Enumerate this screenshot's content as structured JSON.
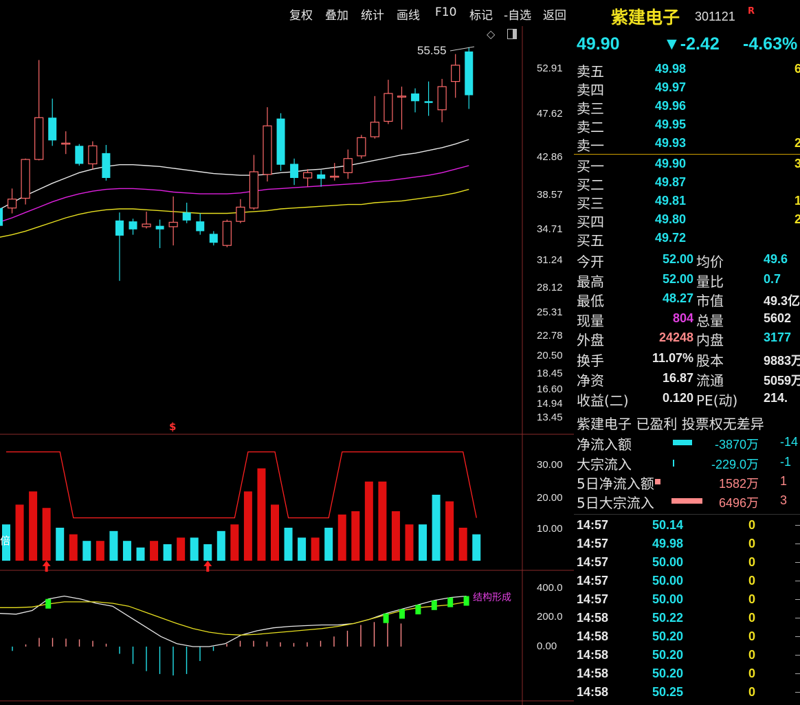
{
  "toolbar": [
    "复权",
    "叠加",
    "统计",
    "画线",
    "F10",
    "标记",
    "-自选",
    "返回"
  ],
  "stock": {
    "name": "紫建电子",
    "code": "301121",
    "flag": "R",
    "price": "49.90",
    "change": "▼-2.42",
    "pct": "-4.63%"
  },
  "main_axis": [
    "52.91",
    "47.62",
    "42.86",
    "38.57",
    "34.71",
    "31.24",
    "28.12",
    "25.31",
    "22.78",
    "20.50",
    "18.45",
    "16.60",
    "14.94",
    "13.45"
  ],
  "high_label": "55.55",
  "vol_axis": [
    "30.00",
    "20.00",
    "10.00"
  ],
  "vol_label": "倍",
  "macd_axis": [
    "400.0",
    "200.0",
    "0.00"
  ],
  "macd_text": "结构形成",
  "signal_char": "$",
  "order_book": {
    "asks": [
      {
        "label": "卖五",
        "price": "49.98",
        "vol": "6"
      },
      {
        "label": "卖四",
        "price": "49.97",
        "vol": ""
      },
      {
        "label": "卖三",
        "price": "49.96",
        "vol": ""
      },
      {
        "label": "卖二",
        "price": "49.95",
        "vol": ""
      },
      {
        "label": "卖一",
        "price": "49.93",
        "vol": "2"
      }
    ],
    "bids": [
      {
        "label": "买一",
        "price": "49.90",
        "vol": "3"
      },
      {
        "label": "买二",
        "price": "49.87",
        "vol": ""
      },
      {
        "label": "买三",
        "price": "49.81",
        "vol": "1"
      },
      {
        "label": "买四",
        "price": "49.80",
        "vol": "2"
      },
      {
        "label": "买五",
        "price": "49.72",
        "vol": ""
      }
    ]
  },
  "stats": [
    {
      "l1": "今开",
      "v1": "52.00",
      "c1": "cyan",
      "l2": "均价",
      "v2": "49.6",
      "c2": "cyan"
    },
    {
      "l1": "最高",
      "v1": "52.00",
      "c1": "cyan",
      "l2": "量比",
      "v2": "0.7",
      "c2": "cyan"
    },
    {
      "l1": "最低",
      "v1": "48.27",
      "c1": "cyan",
      "l2": "市值",
      "v2": "49.3亿",
      "c2": "white"
    },
    {
      "l1": "现量",
      "v1": "804",
      "c1": "magenta",
      "l2": "总量",
      "v2": "5602",
      "c2": "white"
    },
    {
      "l1": "外盘",
      "v1": "24248",
      "c1": "pink",
      "l2": "内盘",
      "v2": "3177",
      "c2": "cyan"
    },
    {
      "l1": "换手",
      "v1": "11.07%",
      "c1": "white",
      "l2": "股本",
      "v2": "9883万",
      "c2": "white"
    },
    {
      "l1": "净资",
      "v1": "16.87",
      "c1": "white",
      "l2": "流通",
      "v2": "5059万",
      "c2": "white"
    },
    {
      "l1": "收益(二)",
      "v1": "0.120",
      "c1": "white",
      "l2": "PE(动)",
      "v2": "214.",
      "c2": "white"
    }
  ],
  "notice": "紫建电子 已盈利 投票权无差异",
  "flows": [
    {
      "label": "净流入额",
      "value": "-3870万",
      "extra": "-14",
      "color": "cyan",
      "bar": "#23e1ea",
      "w": 28,
      "h": 8
    },
    {
      "label": "大宗流入",
      "value": "-229.0万",
      "extra": "-1",
      "color": "cyan",
      "bar": "#23e1ea",
      "w": 2,
      "h": 10
    },
    {
      "label": "5日净流入额",
      "value": "1582万",
      "extra": "1",
      "color": "pink",
      "bar": "#ff8a8a",
      "w": 8,
      "h": 8
    },
    {
      "label": "5日大宗流入",
      "value": "6496万",
      "extra": "3",
      "color": "pink",
      "bar": "#ff8a8a",
      "w": 45,
      "h": 8
    }
  ],
  "ticks": [
    {
      "time": "14:57",
      "price": "50.14",
      "vol": "0"
    },
    {
      "time": "14:57",
      "price": "49.98",
      "vol": "0"
    },
    {
      "time": "14:57",
      "price": "50.00",
      "vol": "0"
    },
    {
      "time": "14:57",
      "price": "50.00",
      "vol": "0"
    },
    {
      "time": "14:57",
      "price": "50.00",
      "vol": "0"
    },
    {
      "time": "14:58",
      "price": "50.22",
      "vol": "0"
    },
    {
      "time": "14:58",
      "price": "50.20",
      "vol": "0"
    },
    {
      "time": "14:58",
      "price": "50.20",
      "vol": "0"
    },
    {
      "time": "14:58",
      "price": "50.20",
      "vol": "0"
    },
    {
      "time": "14:58",
      "price": "50.25",
      "vol": "0"
    }
  ],
  "chart_data": {
    "type": "candlestick",
    "candles": [
      {
        "o": 37.2,
        "c": 35.2,
        "h": 37.6,
        "l": 34.8
      },
      {
        "o": 37.2,
        "c": 38.2,
        "h": 39.4,
        "l": 36.6
      },
      {
        "o": 38.3,
        "c": 42.7,
        "h": 42.8,
        "l": 37.6
      },
      {
        "o": 42.7,
        "c": 47.3,
        "h": 54.0,
        "l": 42.6
      },
      {
        "o": 47.3,
        "c": 44.8,
        "h": 49.5,
        "l": 44.2
      },
      {
        "o": 44.5,
        "c": 44.5,
        "h": 45.8,
        "l": 43.3
      },
      {
        "o": 44.2,
        "c": 42.2,
        "h": 44.4,
        "l": 42.0
      },
      {
        "o": 42.2,
        "c": 44.2,
        "h": 44.7,
        "l": 41.6
      },
      {
        "o": 43.4,
        "c": 40.6,
        "h": 44.3,
        "l": 40.3
      },
      {
        "o": 35.8,
        "c": 34.1,
        "h": 36.7,
        "l": 29.0
      },
      {
        "o": 35.7,
        "c": 34.8,
        "h": 36.0,
        "l": 34.2
      },
      {
        "o": 35.1,
        "c": 35.4,
        "h": 36.8,
        "l": 34.9
      },
      {
        "o": 35.2,
        "c": 34.8,
        "h": 35.9,
        "l": 32.7
      },
      {
        "o": 35.1,
        "c": 35.6,
        "h": 38.5,
        "l": 33.0
      },
      {
        "o": 36.7,
        "c": 35.8,
        "h": 37.8,
        "l": 35.5
      },
      {
        "o": 35.7,
        "c": 34.6,
        "h": 36.6,
        "l": 34.2
      },
      {
        "o": 34.3,
        "c": 33.3,
        "h": 34.6,
        "l": 33.0
      },
      {
        "o": 33.0,
        "c": 35.7,
        "h": 35.9,
        "l": 32.8
      },
      {
        "o": 35.7,
        "c": 37.3,
        "h": 38.2,
        "l": 35.5
      },
      {
        "o": 37.2,
        "c": 41.3,
        "h": 43.2,
        "l": 37.0
      },
      {
        "o": 41.0,
        "c": 46.4,
        "h": 48.5,
        "l": 40.2
      },
      {
        "o": 47.2,
        "c": 42.1,
        "h": 47.8,
        "l": 41.4
      },
      {
        "o": 42.2,
        "c": 40.6,
        "h": 42.8,
        "l": 39.8
      },
      {
        "o": 40.6,
        "c": 41.2,
        "h": 41.6,
        "l": 39.6
      },
      {
        "o": 41.0,
        "c": 40.5,
        "h": 41.5,
        "l": 39.6
      },
      {
        "o": 40.7,
        "c": 40.8,
        "h": 42.3,
        "l": 40.3
      },
      {
        "o": 41.2,
        "c": 42.8,
        "h": 43.8,
        "l": 40.5
      },
      {
        "o": 43.1,
        "c": 45.1,
        "h": 45.4,
        "l": 42.8
      },
      {
        "o": 45.2,
        "c": 46.8,
        "h": 49.8,
        "l": 45.0
      },
      {
        "o": 46.9,
        "c": 50.1,
        "h": 51.7,
        "l": 46.6
      },
      {
        "o": 49.8,
        "c": 49.8,
        "h": 50.9,
        "l": 46.0
      },
      {
        "o": 50.1,
        "c": 49.2,
        "h": 50.7,
        "l": 47.9
      },
      {
        "o": 49.2,
        "c": 49.0,
        "h": 51.5,
        "l": 47.5
      },
      {
        "o": 48.2,
        "c": 50.9,
        "h": 51.8,
        "l": 46.8
      },
      {
        "o": 51.5,
        "c": 53.4,
        "h": 54.7,
        "l": 49.6
      },
      {
        "o": 55.0,
        "c": 49.9,
        "h": 55.5,
        "l": 48.3
      }
    ],
    "ma_white": [
      37.0,
      37.8,
      38.6,
      39.3,
      40.0,
      40.6,
      41.2,
      41.6,
      41.9,
      42.1,
      42.1,
      42.0,
      41.9,
      41.7,
      41.5,
      41.3,
      41.1,
      41.0,
      40.9,
      40.9,
      41.0,
      41.2,
      41.3,
      41.5,
      41.6,
      41.8,
      42.0,
      42.3,
      42.6,
      42.9,
      43.2,
      43.4,
      43.7,
      44.0,
      44.4,
      44.9
    ],
    "ma_magenta": [
      35.6,
      36.1,
      36.7,
      37.3,
      37.9,
      38.4,
      38.8,
      39.1,
      39.3,
      39.4,
      39.4,
      39.3,
      39.2,
      39.0,
      38.9,
      38.8,
      38.8,
      38.8,
      38.9,
      39.1,
      39.3,
      39.4,
      39.5,
      39.6,
      39.7,
      39.8,
      39.9,
      40.0,
      40.2,
      40.3,
      40.5,
      40.7,
      40.9,
      41.2,
      41.6,
      42.0
    ],
    "ma_yellow": [
      33.9,
      34.2,
      34.6,
      35.1,
      35.6,
      36.1,
      36.5,
      36.8,
      37.0,
      37.1,
      37.1,
      37.0,
      36.9,
      36.8,
      36.7,
      36.6,
      36.6,
      36.6,
      36.7,
      36.8,
      36.9,
      37.1,
      37.2,
      37.3,
      37.4,
      37.5,
      37.6,
      37.6,
      37.8,
      37.9,
      38.0,
      38.2,
      38.4,
      38.6,
      38.9,
      39.3
    ],
    "volume_ratio": [
      11,
      17,
      21,
      16,
      10,
      8,
      6,
      6,
      9,
      6,
      4,
      6,
      5,
      7,
      7,
      5,
      9,
      11,
      21,
      28,
      17,
      10,
      7,
      7,
      10,
      14,
      15,
      24,
      24,
      15,
      11,
      11,
      20,
      18,
      10,
      8
    ],
    "volume_upper": [
      33,
      33,
      33,
      33,
      33,
      13,
      13,
      13,
      13,
      13,
      13,
      13,
      13,
      13,
      13,
      13,
      13,
      13,
      33,
      33,
      33,
      13,
      13,
      13,
      13,
      33,
      33,
      33,
      33,
      33,
      33,
      33,
      33,
      33,
      33,
      13
    ],
    "volume_arrows": [
      3,
      15
    ],
    "macd_white": [
      230,
      225,
      250,
      330,
      350,
      330,
      300,
      280,
      210,
      140,
      70,
      20,
      0,
      0,
      20,
      80,
      110,
      130,
      140,
      145,
      150,
      150,
      160,
      190,
      230,
      260,
      290,
      320,
      340,
      350
    ],
    "macd_yellow": [
      270,
      270,
      275,
      295,
      310,
      310,
      310,
      300,
      280,
      240,
      200,
      160,
      125,
      100,
      85,
      80,
      85,
      95,
      105,
      115,
      125,
      140,
      160,
      190,
      220,
      250,
      270,
      280,
      290,
      310
    ],
    "macd_hist": [
      -30,
      15,
      60,
      60,
      55,
      50,
      40,
      20,
      -50,
      -120,
      -170,
      -190,
      -200,
      -190,
      -100,
      -30,
      20,
      40,
      40,
      35,
      30,
      25,
      30,
      40,
      70,
      110,
      150,
      170,
      180,
      160
    ],
    "macd_green": [
      3,
      24,
      25,
      26,
      27,
      28,
      29
    ]
  }
}
